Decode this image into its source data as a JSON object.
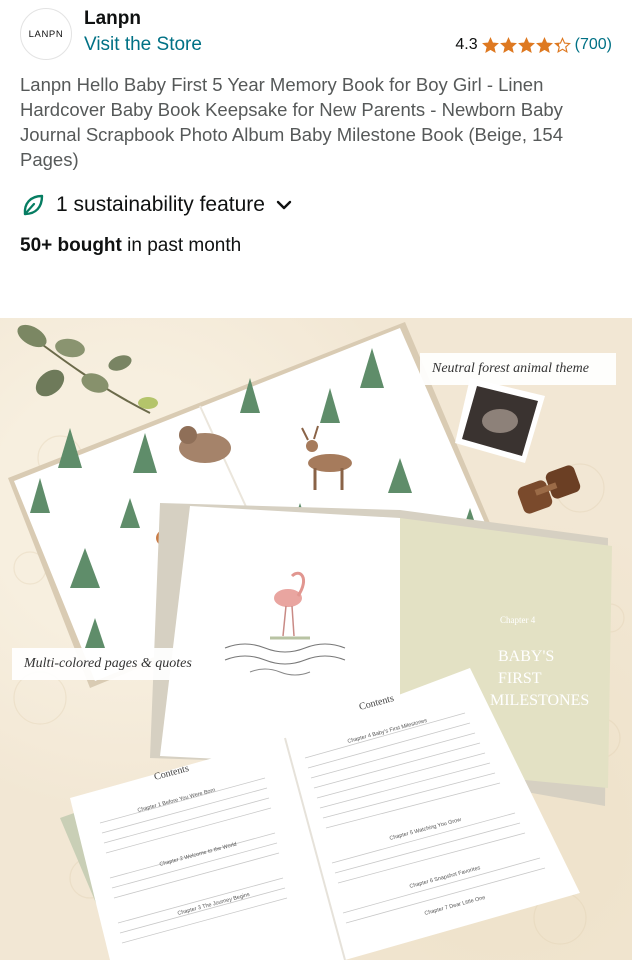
{
  "brand": {
    "logo_text": "LANPN",
    "name": "Lanpn",
    "visit_store": "Visit the Store"
  },
  "rating": {
    "value": "4.3",
    "stars": 4.3,
    "count": "(700)",
    "star_color": "#de7921"
  },
  "product": {
    "title": "Lanpn Hello Baby First 5 Year Memory Book for Boy Girl - Linen Hardcover Baby Book Keepsake for New Parents - Newborn Baby Journal Scrapbook Photo Album Baby Milestone Book (Beige, 154 Pages)",
    "sustainability_label": "1 sustainability feature",
    "bought_bold": "50+ bought",
    "bought_rest": " in past month"
  },
  "image": {
    "callout_forest": "Neutral forest animal theme",
    "callout_pages": "Multi-colored pages & quotes",
    "contents_heading_right": "Contents",
    "contents_heading_left": "Contents",
    "chapter_sign": "Chapter 4",
    "chapter_title_lines": [
      "BABY'S",
      "FIRST",
      "MILESTONES"
    ],
    "toc_left": [
      "Chapter 1 Before You Were Born",
      "Chapter 2 Welcome to the World",
      "Chapter 3 The Journey Begins"
    ],
    "toc_right": [
      "Chapter 4 Baby's First Milestones",
      "Chapter 5 Watching You Grow",
      "Chapter 6 Snapshot Favorites",
      "Chapter 7 Dear Little One"
    ]
  },
  "colors": {
    "link": "#007185",
    "text": "#0f1111",
    "muted": "#565959",
    "leaf": "#067d62"
  }
}
